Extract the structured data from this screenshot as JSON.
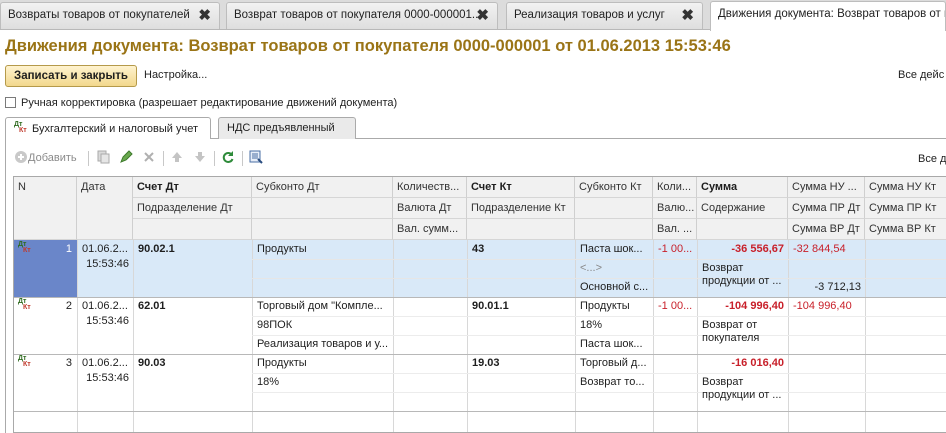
{
  "tabs": [
    {
      "label": "Возвраты товаров от покупателей",
      "close": "✖"
    },
    {
      "label": "Возврат товаров от покупателя 0000-000001...",
      "close": "✖"
    },
    {
      "label": "Реализация товаров и услуг",
      "close": "✖"
    },
    {
      "label": "Движения документа: Возврат товаров от пок",
      "close": ""
    }
  ],
  "title": "Движения документа: Возврат товаров от покупателя 0000-000001 от 01.06.2013 15:53:46",
  "toolbar": {
    "save_label": "Записать и закрыть",
    "settings_label": "Настройка...",
    "all_actions_label": "Все дейс"
  },
  "manual_edit_label": "Ручная корректировка (разрешает редактирование движений документа)",
  "sub_tabs": [
    "Бухгалтерский и налоговый учет",
    "НДС предъявленный"
  ],
  "grid_toolbar": {
    "add_label": "Добавить",
    "all_actions_label": "Все д"
  },
  "columns": {
    "n": "N",
    "date": "Дата",
    "debit": "Счет Дт",
    "debit_dept": "Подразделение Дт",
    "subconto_dt": "Субконто Дт",
    "qty": "Количеств...",
    "currency_dt": "Валюта Дт",
    "cur_sum": "Вал. сумм...",
    "credit": "Счет Кт",
    "credit_dept": "Подразделение Кт",
    "subconto_kt": "Субконто Кт",
    "qty_kt": "Коли...",
    "cur_kt": "Валю...",
    "cur_sum_kt": "Вал. ...",
    "sum": "Сумма",
    "content": "Содержание",
    "nu_dt": "Сумма НУ ...",
    "pr_dt": "Сумма ПР Дт",
    "vr_dt": "Сумма ВР Дт",
    "nu_kt": "Сумма НУ Кт",
    "pr_kt": "Сумма ПР Кт",
    "vr_kt": "Сумма ВР Кт"
  },
  "rows": [
    {
      "n": "1",
      "date": "01.06.2...",
      "time": "15:53:46",
      "debit": "90.02.1",
      "subconto_dt": [
        "Продукты"
      ],
      "credit": "43",
      "subconto_kt": [
        "Паста шок...",
        "<...>",
        "Основной с..."
      ],
      "qty_kt": "-1 00...",
      "sum": "-36 556,67",
      "content": "Возврат продукции от ...",
      "nu_dt": "-32 844,54",
      "vr_dt": "-3 712,13"
    },
    {
      "n": "2",
      "date": "01.06.2...",
      "time": "15:53:46",
      "debit": "62.01",
      "subconto_dt": [
        "Торговый дом \"Компле...",
        "98ПОК",
        "Реализация товаров и у..."
      ],
      "credit": "90.01.1",
      "subconto_kt": [
        "Продукты",
        "18%",
        "Паста шок..."
      ],
      "qty_kt": "-1 00...",
      "sum": "-104 996,40",
      "content": "Возврат от покупателя",
      "nu_dt": "-104 996,40"
    },
    {
      "n": "3",
      "date": "01.06.2...",
      "time": "15:53:46",
      "debit": "90.03",
      "subconto_dt": [
        "Продукты",
        "18%"
      ],
      "credit": "19.03",
      "subconto_kt": [
        "Торговый д...",
        "Возврат то..."
      ],
      "sum": "-16 016,40",
      "content": "Возврат продукции от ..."
    }
  ],
  "icons": {
    "dtkt_d": "Дт",
    "dtkt_k": "Кт"
  },
  "colors": {
    "title": "#9a7416",
    "selection": "#d9e9f8",
    "negative": "#c8202a"
  }
}
